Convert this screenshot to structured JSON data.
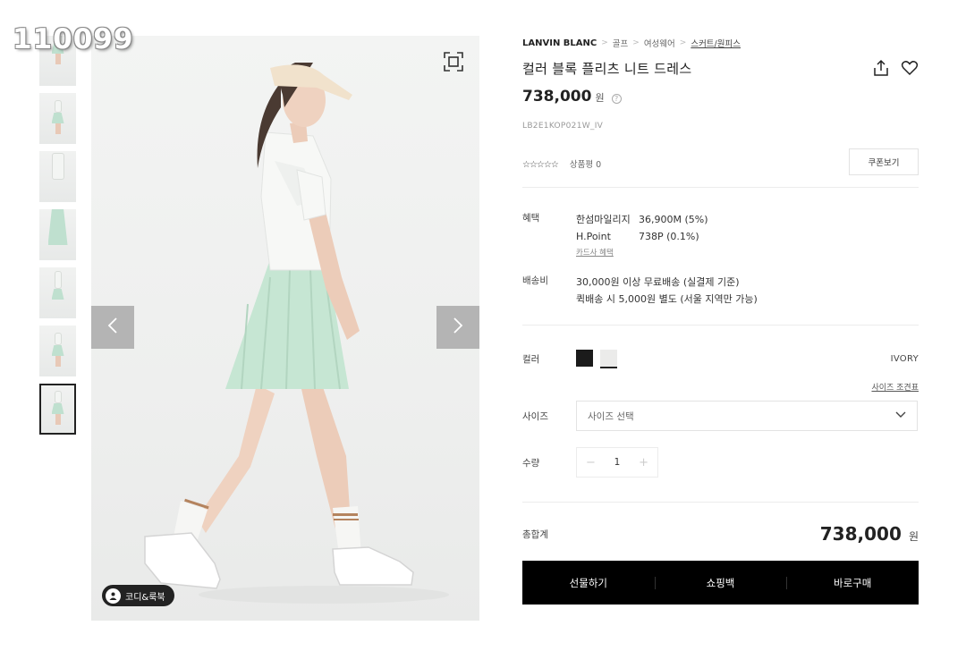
{
  "watermark": "110099",
  "breadcrumb": {
    "brand": "LANVIN BLANC",
    "items": [
      "골프",
      "여성웨어",
      "스커트/원피스"
    ]
  },
  "product": {
    "title": "컬러 블록 플리츠 니트 드레스",
    "price": "738,000",
    "currency": "원",
    "sku": "LB2E1KOP021W_IV",
    "stars": "☆☆☆☆☆",
    "review_label": "상품평 0",
    "coupon_label": "쿠폰보기"
  },
  "benefits": {
    "label": "혜택",
    "lines": [
      {
        "name": "한섬마일리지",
        "value": "36,900M (5%)"
      },
      {
        "name": "H.Point",
        "value": "738P (0.1%)"
      }
    ],
    "card_link": "카드사 혜택"
  },
  "shipping": {
    "label": "배송비",
    "line1": "30,000원 이상 무료배송 (실결제 기준)",
    "line2": "퀵배송 시 5,000원 별도 (서울 지역만 가능)"
  },
  "color": {
    "label": "컬러",
    "selected": "IVORY",
    "swatches": [
      "#1b1b1b",
      "#ebebea"
    ]
  },
  "size": {
    "chart_link": "사이즈 조견표",
    "label": "사이즈",
    "placeholder": "사이즈 선택"
  },
  "quantity": {
    "label": "수량",
    "value": "1",
    "minus": "−",
    "plus": "+"
  },
  "total": {
    "label": "총합계",
    "price": "738,000",
    "currency": "원"
  },
  "actions": {
    "gift": "선물하기",
    "cart": "쇼핑백",
    "buy": "바로구매"
  },
  "image": {
    "codi_badge": "코디&룩북"
  }
}
